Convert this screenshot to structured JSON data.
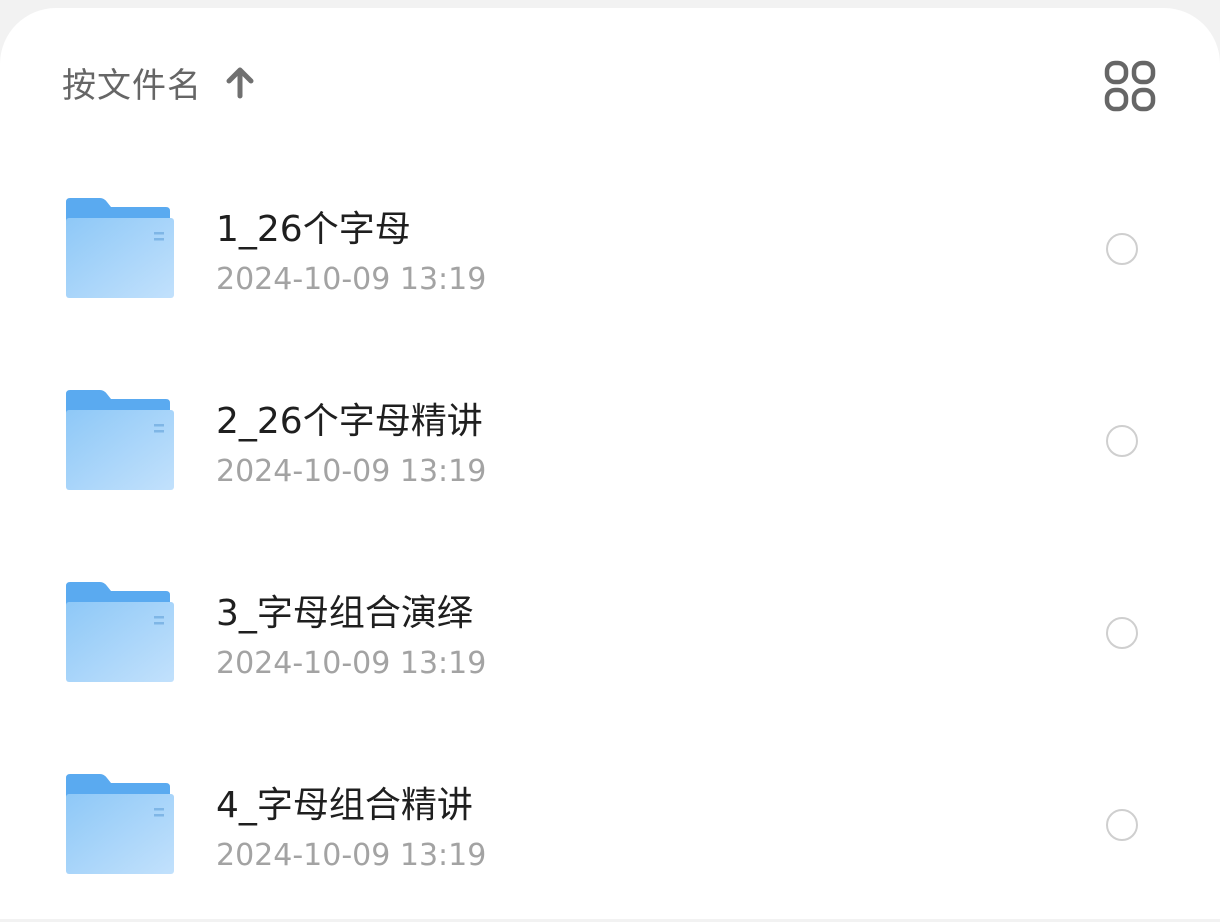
{
  "sort": {
    "label": "按文件名",
    "direction_icon": "arrow-up-icon"
  },
  "view_toggle": {
    "icon": "grid-view-icon"
  },
  "colors": {
    "folder_tab": "#5aaaf0",
    "folder_front_light": "#b9dcfb",
    "folder_front_dark": "#7fbff5",
    "title_text": "#1f1f1f",
    "meta_text": "#a3a3a3",
    "radio_border": "#cfcfcf"
  },
  "files": [
    {
      "name": "1_26个字母",
      "date": "2024-10-09 13:19",
      "selected": false
    },
    {
      "name": "2_26个字母精讲",
      "date": "2024-10-09 13:19",
      "selected": false
    },
    {
      "name": "3_字母组合演绎",
      "date": "2024-10-09 13:19",
      "selected": false
    },
    {
      "name": "4_字母组合精讲",
      "date": "2024-10-09 13:19",
      "selected": false
    }
  ]
}
